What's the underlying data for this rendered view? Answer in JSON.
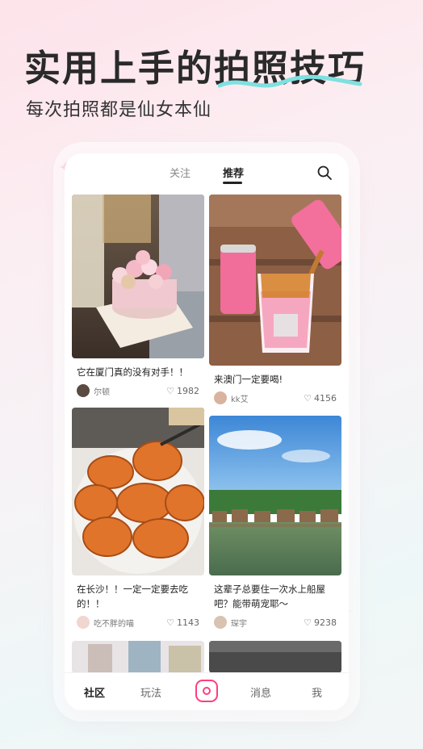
{
  "marketing": {
    "headline": "实用上手的拍照技巧",
    "subheadline": "每次拍照都是仙女本仙"
  },
  "top_nav": {
    "tabs": [
      "关注",
      "推荐"
    ],
    "active_tab": "推荐",
    "search_icon": "search-icon"
  },
  "feed": [
    {
      "title": "它在厦门真的没有对手！！",
      "author": "尔顿",
      "likes": "1982",
      "image": "cake-photo"
    },
    {
      "title": "来澳门一定要喝!",
      "author": "kk艾",
      "likes": "4156",
      "image": "pink-drink-photo"
    },
    {
      "title": "在长沙！！一定一定要去吃的！！",
      "author": "吃不胖的喵",
      "likes": "1143",
      "image": "crab-photo"
    },
    {
      "title": "这辈子总要住一次水上船屋吧？能带萌宠耶～",
      "author": "琛宇",
      "likes": "9238",
      "image": "lake-houses-photo"
    }
  ],
  "bottom_nav": {
    "items": [
      "社区",
      "玩法",
      "消息",
      "我"
    ],
    "active": "社区",
    "center_icon": "camera-icon"
  },
  "colors": {
    "accent": "#ff3f7a",
    "headline_squiggle": "#7ee0e0"
  }
}
